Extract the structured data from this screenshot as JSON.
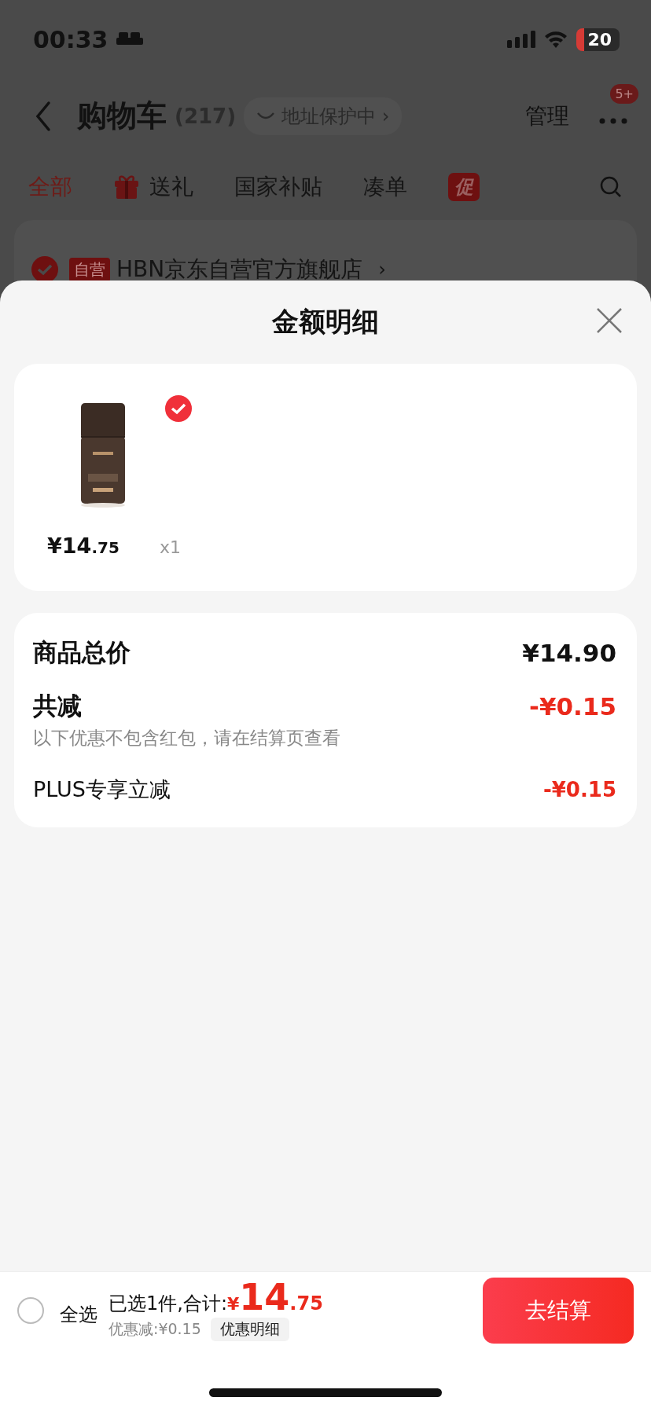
{
  "status_bar": {
    "time": "00:33",
    "battery": "20"
  },
  "nav": {
    "title": "购物车",
    "count": "(217)",
    "address_pill": "地址保护中 ›",
    "manage": "管理",
    "more_badge": "5+"
  },
  "tabs": [
    {
      "label": "全部",
      "selected": true,
      "kind": "text"
    },
    {
      "label": "送礼",
      "selected": false,
      "kind": "gift"
    },
    {
      "label": "国家补贴",
      "selected": false,
      "kind": "text"
    },
    {
      "label": "凑单",
      "selected": false,
      "kind": "text"
    },
    {
      "label": "促",
      "selected": false,
      "kind": "badge"
    }
  ],
  "store": {
    "checked": true,
    "tag": "自营",
    "name": "HBN京东自营官方旗舰店",
    "chevron": "›"
  },
  "sheet": {
    "title": "金额明细"
  },
  "items": [
    {
      "checked": true,
      "price_main": "¥14",
      "price_decimal": ".75",
      "quantity": "x1"
    }
  ],
  "summary": {
    "rows": [
      {
        "kind": "total",
        "label": "商品总价",
        "value": "¥14.90"
      },
      {
        "kind": "discount",
        "label": "共减",
        "value": "-¥0.15",
        "note": "以下优惠不包含红包，请在结算页查看"
      },
      {
        "kind": "detail",
        "label": "PLUS专享立减",
        "value": "-¥0.15"
      }
    ]
  },
  "bottom_bar": {
    "select_all": {
      "label": "全选",
      "checked": false
    },
    "summary": "已选1件,合计:",
    "currency": "¥",
    "total_main": "14",
    "total_decimal": ".75",
    "discount": "优惠减:¥0.15",
    "details_button": "优惠明细",
    "checkout": "去结算"
  }
}
